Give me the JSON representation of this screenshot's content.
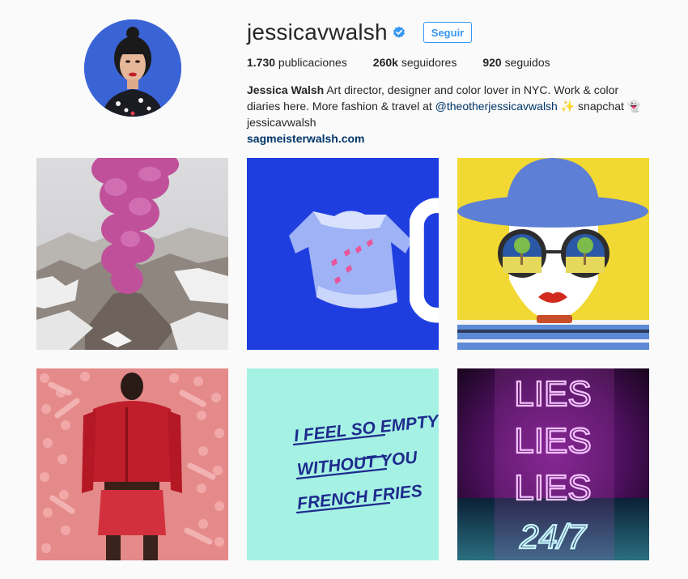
{
  "profile": {
    "username": "jessicavwalsh",
    "follow_label": "Seguir",
    "stats": {
      "posts_count": "1.730",
      "posts_label": " publicaciones",
      "followers_count": "260k",
      "followers_label": " seguidores",
      "following_count": "920",
      "following_label": " seguidos"
    },
    "bio": {
      "full_name": "Jessica Walsh",
      "text_1": " Art director, designer and color lover in NYC. Work & color diaries here. More fashion & travel at ",
      "mention": "@theotherjessicavwalsh",
      "text_2": " ✨ snapchat 👻 jessicavwalsh",
      "website": "sagmeisterwalsh.com"
    }
  },
  "posts": {
    "tile5_text": [
      "I FEEL SO EMPTY",
      "WITHOUT YOU",
      "FRENCH FRIES"
    ],
    "tile6_text": [
      "LIES",
      "LIES",
      "LIES",
      "24/7"
    ]
  },
  "colors": {
    "accent": "#3897f0",
    "link": "#003569"
  }
}
